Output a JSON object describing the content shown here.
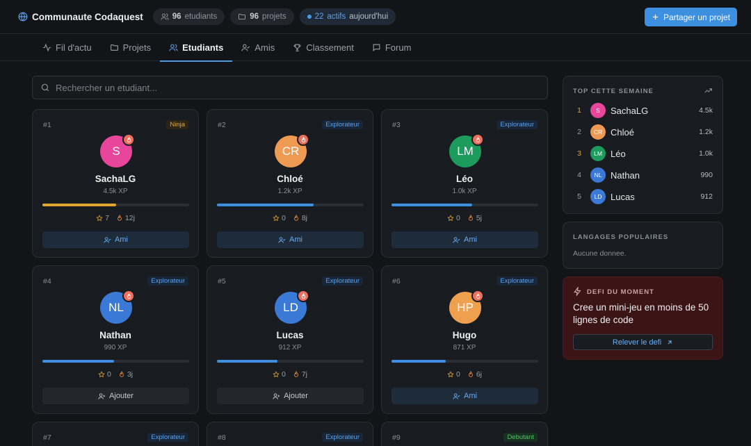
{
  "header": {
    "app_title": "Communaute Codaquest",
    "students_count": "96",
    "students_label": "etudiants",
    "projects_count": "96",
    "projects_label": "projets",
    "active_count": "22",
    "active_word": "actifs",
    "active_suffix": "aujourd'hui",
    "share_label": "Partager un projet"
  },
  "tabs": [
    {
      "label": "Fil d'actu",
      "icon": "activity-icon"
    },
    {
      "label": "Projets",
      "icon": "folder-icon"
    },
    {
      "label": "Etudiants",
      "icon": "users-icon",
      "active": true
    },
    {
      "label": "Amis",
      "icon": "user-check-icon"
    },
    {
      "label": "Classement",
      "icon": "trophy-icon"
    },
    {
      "label": "Forum",
      "icon": "message-icon"
    }
  ],
  "search": {
    "placeholder": "Rechercher un etudiant..."
  },
  "students": [
    {
      "rank": "#1",
      "badge": "Ninja",
      "initials": "S",
      "name": "SachaLG",
      "xp": "4.5k XP",
      "progress": 0.5,
      "stars": "7",
      "streak": "12j",
      "action": "Ami",
      "color": "#e8469a"
    },
    {
      "rank": "#2",
      "badge": "Explorateur",
      "initials": "CR",
      "name": "Chloé",
      "xp": "1.2k XP",
      "progress": 0.66,
      "stars": "0",
      "streak": "8j",
      "action": "Ami",
      "color": "#ee9a52"
    },
    {
      "rank": "#3",
      "badge": "Explorateur",
      "initials": "LM",
      "name": "Léo",
      "xp": "1.0k XP",
      "progress": 0.55,
      "stars": "0",
      "streak": "5j",
      "action": "Ami",
      "color": "#1c9b5c"
    },
    {
      "rank": "#4",
      "badge": "Explorateur",
      "initials": "NL",
      "name": "Nathan",
      "xp": "990 XP",
      "progress": 0.49,
      "stars": "0",
      "streak": "3j",
      "action": "Ajouter",
      "color": "#3b79d6"
    },
    {
      "rank": "#5",
      "badge": "Explorateur",
      "initials": "LD",
      "name": "Lucas",
      "xp": "912 XP",
      "progress": 0.41,
      "stars": "0",
      "streak": "7j",
      "action": "Ajouter",
      "color": "#3b79d6"
    },
    {
      "rank": "#6",
      "badge": "Explorateur",
      "initials": "HP",
      "name": "Hugo",
      "xp": "871 XP",
      "progress": 0.37,
      "stars": "0",
      "streak": "6j",
      "action": "Ami",
      "color": "#eea04f"
    }
  ],
  "partial_cards": [
    {
      "rank": "#7",
      "badge": "Explorateur"
    },
    {
      "rank": "#8",
      "badge": "Explorateur"
    },
    {
      "rank": "#9",
      "badge": "Debutant"
    }
  ],
  "leaderboard": {
    "title": "TOP CETTE SEMAINE",
    "rows": [
      {
        "pos": "1",
        "initials": "S",
        "name": "SachaLG",
        "xp": "4.5k",
        "color": "#e8469a"
      },
      {
        "pos": "2",
        "initials": "CR",
        "name": "Chloé",
        "xp": "1.2k",
        "color": "#ee9a52"
      },
      {
        "pos": "3",
        "initials": "LM",
        "name": "Léo",
        "xp": "1.0k",
        "color": "#1c9b5c"
      },
      {
        "pos": "4",
        "initials": "NL",
        "name": "Nathan",
        "xp": "990",
        "color": "#3b79d6"
      },
      {
        "pos": "5",
        "initials": "LD",
        "name": "Lucas",
        "xp": "912",
        "color": "#3b79d6"
      }
    ]
  },
  "languages": {
    "title": "LANGAGES POPULAIRES",
    "empty": "Aucune donnee."
  },
  "challenge": {
    "title": "DEFI DU MOMENT",
    "text": "Cree un mini-jeu en moins de 50 lignes de code",
    "button": "Relever le defi"
  }
}
